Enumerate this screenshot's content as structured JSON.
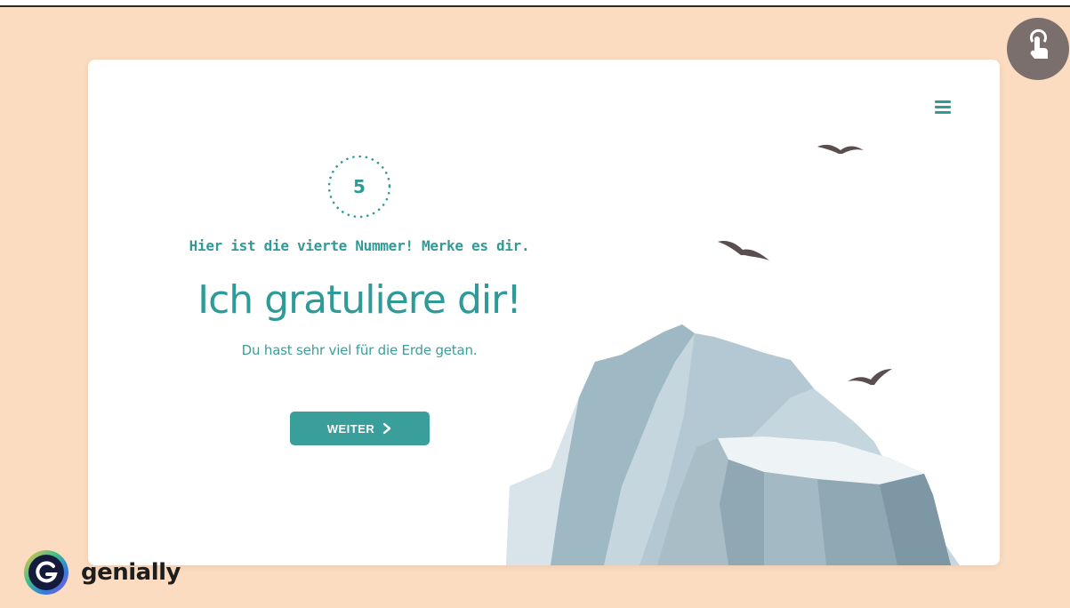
{
  "card": {
    "counter": "5",
    "hint": "Hier ist die vierte Nummer! Merke es dir.",
    "headline": "Ich gratuliere dir!",
    "subtitle": "Du hast sehr viel für die Erde getan.",
    "next_label": "WEITER"
  },
  "brand": {
    "name": "genially"
  },
  "colors": {
    "background": "#fcdcc0",
    "accent": "#3a9e9b",
    "card": "#ffffff",
    "touch_button": "#7a6f6c"
  },
  "icons": {
    "menu": "hamburger-menu-icon",
    "next": "chevron-right-icon",
    "touch": "touch-hand-icon",
    "logo": "genially-logo-icon"
  }
}
